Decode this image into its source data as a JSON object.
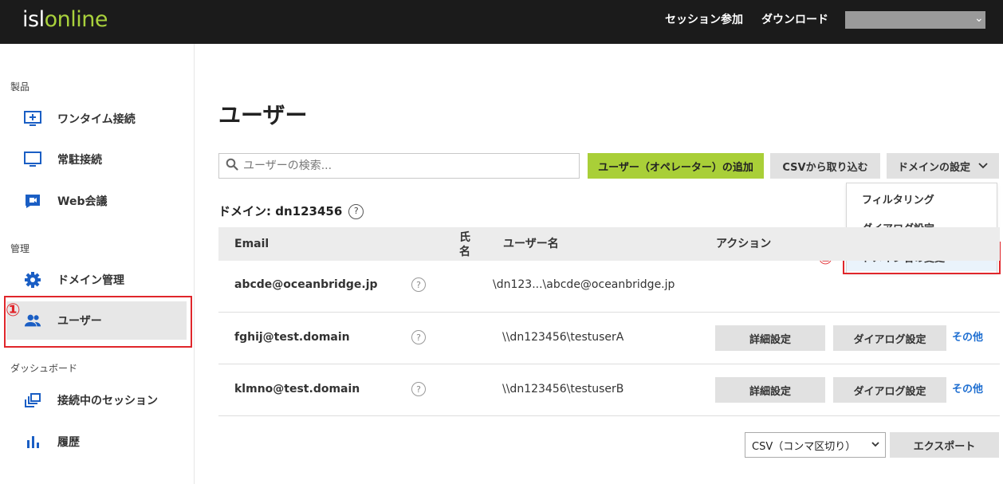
{
  "header": {
    "logo_isl": "isl",
    "logo_online": "online",
    "nav_join": "セッション参加",
    "nav_download": "ダウンロード",
    "user_caret": "⌄"
  },
  "sidebar": {
    "section_products": "製品",
    "section_admin": "管理",
    "section_dashboard": "ダッシュボード",
    "items": [
      {
        "label": "ワンタイム接続",
        "icon": "monitor-plus-icon"
      },
      {
        "label": "常駐接続",
        "icon": "monitor-icon"
      },
      {
        "label": "Web会議",
        "icon": "video-camera-icon"
      },
      {
        "label": "ドメイン管理",
        "icon": "gear-icon"
      },
      {
        "label": "ユーザー",
        "icon": "users-icon",
        "active": true
      },
      {
        "label": "接続中のセッション",
        "icon": "sessions-icon"
      },
      {
        "label": "履歴",
        "icon": "bar-chart-icon"
      }
    ]
  },
  "annotations": {
    "one": "①",
    "two": "②",
    "color": "#e0262b"
  },
  "main": {
    "title": "ユーザー",
    "search_placeholder": "ユーザーの検索...",
    "add_user_label": "ユーザー（オペレーター）の追加",
    "import_csv_label": "CSVから取り込む",
    "domain_settings_label": "ドメインの設定",
    "dropdown": [
      "フィルタリング",
      "ダイアログ設定",
      "ドメイン名の変更"
    ],
    "domain_label": "ドメイン: dn123456",
    "columns": {
      "email": "Email",
      "name_1": "氏",
      "name_2": "名",
      "username": "ユーザー名",
      "actions": "アクション"
    },
    "rows": [
      {
        "email": "abcde@oceanbridge.jp",
        "username": "\\dn123...\\abcde@oceanbridge.jp"
      },
      {
        "email": "fghij@test.domain",
        "username": "\\\\dn123456\\testuserA",
        "details": "詳細設定",
        "dialog": "ダイアログ設定",
        "more": "その他"
      },
      {
        "email": "klmno@test.domain",
        "username": "\\\\dn123456\\testuserB",
        "details": "詳細設定",
        "dialog": "ダイアログ設定",
        "more": "その他"
      }
    ],
    "export_format": "CSV（コンマ区切り）",
    "export_label": "エクスポート"
  },
  "colors": {
    "accent_green": "#a9cf38",
    "link_blue": "#1f6fd1",
    "topbar": "#1b1b1b"
  }
}
